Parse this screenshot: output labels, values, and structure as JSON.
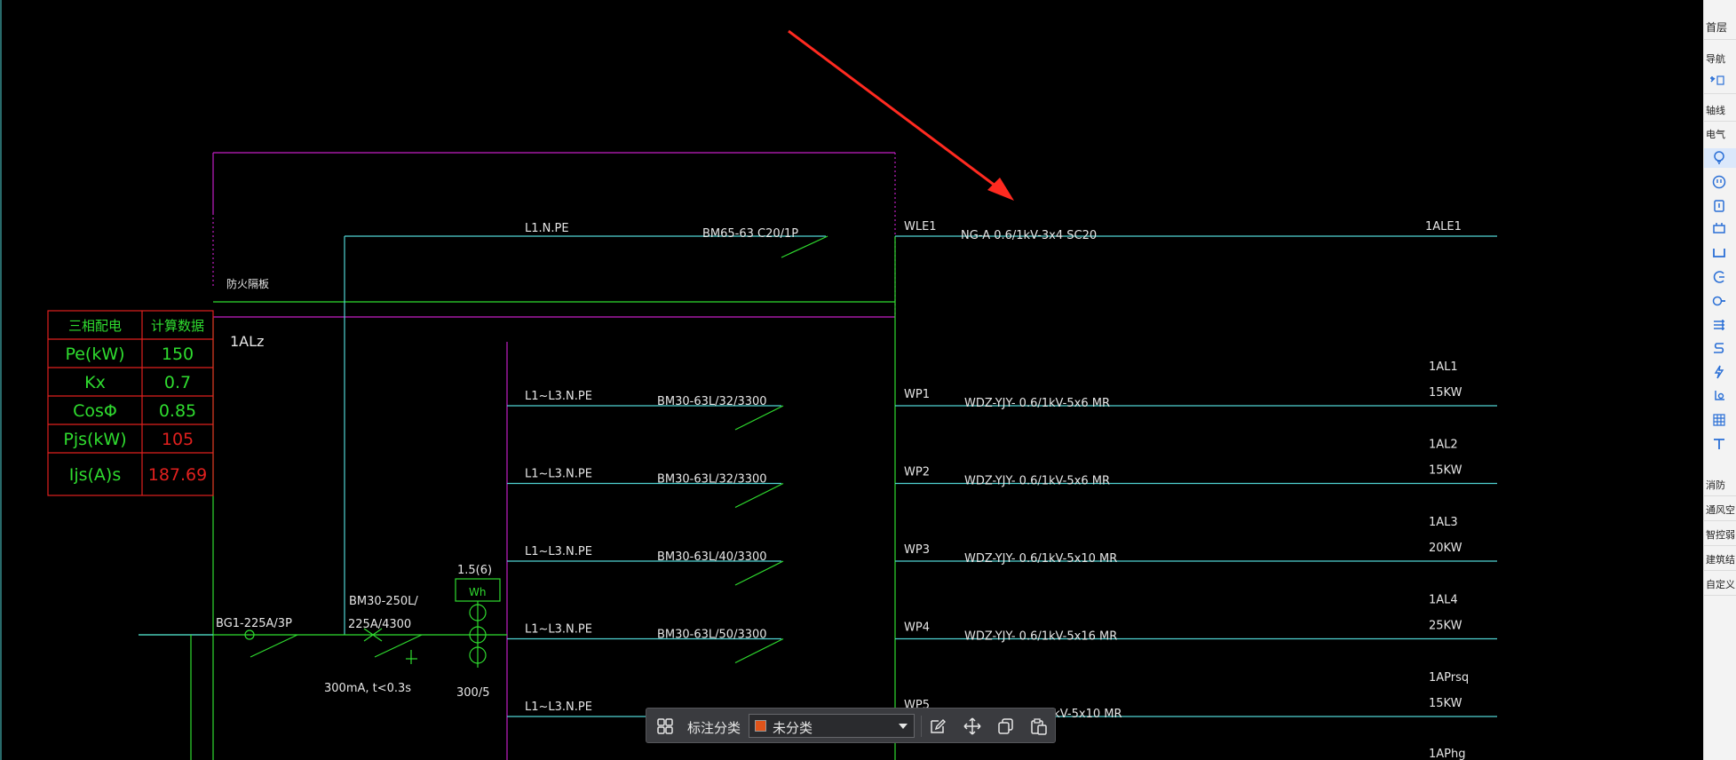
{
  "colors": {
    "background": "#000000",
    "cyan": "#4fd3d3",
    "green": "#2fdc2f",
    "magenta": "#c21fc4",
    "red_frame": "#e0201e",
    "white_text": "#e6e6e6",
    "annotation_arrow": "#ff2a20",
    "toolbar_bg": "#3a3b3f",
    "swatch": "#e0541a"
  },
  "drawing": {
    "main_circuit": {
      "label": "1ALz",
      "phase": "L1.N.PE",
      "breaker": "BM65-63 C20/1P",
      "circuit_id": "WLE1",
      "cable": "NG-A 0.6/1kV-3x4 SC20",
      "target": "1ALE1",
      "partition_label": "防火隔板"
    },
    "load_table": {
      "headers": [
        "三相配电",
        "计算数据"
      ],
      "rows": [
        {
          "name": "Pe(kW)",
          "value": "150",
          "value_color": "green"
        },
        {
          "name": "Kx",
          "value": "0.7",
          "value_color": "green"
        },
        {
          "name": "CosΦ",
          "value": "0.85",
          "value_color": "green"
        },
        {
          "name": "Pjs(kW)",
          "value": "105",
          "value_color": "red"
        },
        {
          "name": "Ijs(A)s",
          "value": "187.69",
          "value_color": "red"
        }
      ]
    },
    "incoming": {
      "main_breaker": "BG1-225A/3P",
      "rcd_model": "BM30-250L/",
      "rcd_rating": "225A/4300",
      "rcd_note": "300mA, t<0.3s",
      "meter_ratio": "1.5(6)",
      "meter_label": "Wh",
      "ct_ratio": "300/5"
    },
    "branches": [
      {
        "phase": "L1~L3.N.PE",
        "breaker": "BM30-63L/32/3300",
        "circuit": "WP1",
        "cable": "WDZ-YJY- 0.6/1kV-5x6 MR",
        "target": "1AL1",
        "power": "15KW"
      },
      {
        "phase": "L1~L3.N.PE",
        "breaker": "BM30-63L/32/3300",
        "circuit": "WP2",
        "cable": "WDZ-YJY- 0.6/1kV-5x6 MR",
        "target": "1AL2",
        "power": "15KW"
      },
      {
        "phase": "L1~L3.N.PE",
        "breaker": "BM30-63L/40/3300",
        "circuit": "WP3",
        "cable": "WDZ-YJY- 0.6/1kV-5x10 MR",
        "target": "1AL3",
        "power": "20KW"
      },
      {
        "phase": "L1~L3.N.PE",
        "breaker": "BM30-63L/50/3300",
        "circuit": "WP4",
        "cable": "WDZ-YJY- 0.6/1kV-5x16 MR",
        "target": "1AL4",
        "power": "25KW"
      },
      {
        "phase": "L1~L3.N.PE",
        "breaker": "",
        "circuit": "WP5",
        "cable": "1kV-5x10 MR",
        "target": "1APrsq",
        "power": "15KW"
      }
    ],
    "extra_target": "1APhg"
  },
  "right_panel": {
    "top_label": "首层",
    "nav_label": "导航",
    "sections": [
      "轴线",
      "电气",
      "消防",
      "通风空",
      "智控弱",
      "建筑结",
      "自定义"
    ],
    "icons": [
      "bulb-icon",
      "socket-icon",
      "switch-icon",
      "panel-icon",
      "tray-icon",
      "wire-icon",
      "pipe-icon",
      "bus-icon",
      "cable-icon",
      "lightning-icon",
      "sensor-icon",
      "grid-icon",
      "tool-icon"
    ]
  },
  "toolbar": {
    "grid_icon": "grid-icon",
    "label": "标注分类",
    "select_value": "未分类",
    "actions": [
      "edit-icon",
      "move-icon",
      "copy-icon",
      "paste-icon"
    ]
  }
}
